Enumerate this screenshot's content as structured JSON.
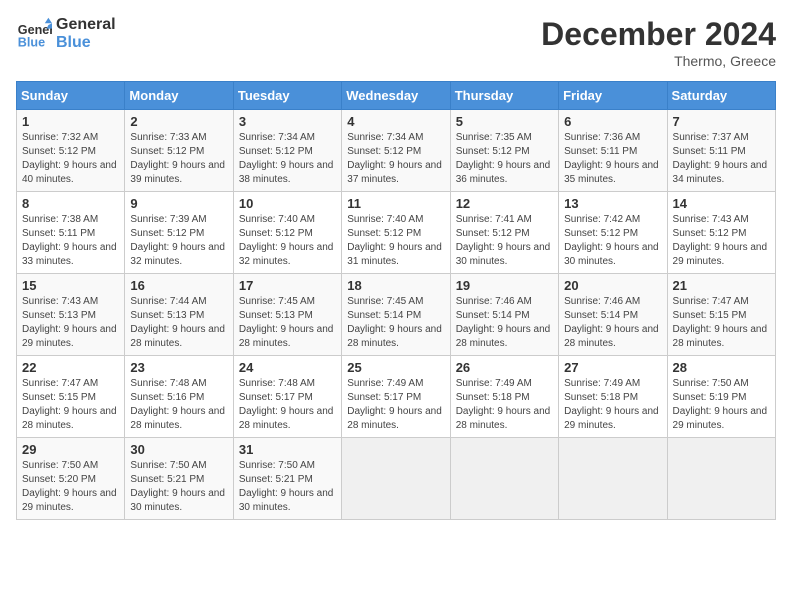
{
  "header": {
    "logo_line1": "General",
    "logo_line2": "Blue",
    "month": "December 2024",
    "location": "Thermo, Greece"
  },
  "days_of_week": [
    "Sunday",
    "Monday",
    "Tuesday",
    "Wednesday",
    "Thursday",
    "Friday",
    "Saturday"
  ],
  "weeks": [
    [
      {
        "day": "1",
        "sunrise": "7:32 AM",
        "sunset": "5:12 PM",
        "daylight": "9 hours and 40 minutes."
      },
      {
        "day": "2",
        "sunrise": "7:33 AM",
        "sunset": "5:12 PM",
        "daylight": "9 hours and 39 minutes."
      },
      {
        "day": "3",
        "sunrise": "7:34 AM",
        "sunset": "5:12 PM",
        "daylight": "9 hours and 38 minutes."
      },
      {
        "day": "4",
        "sunrise": "7:34 AM",
        "sunset": "5:12 PM",
        "daylight": "9 hours and 37 minutes."
      },
      {
        "day": "5",
        "sunrise": "7:35 AM",
        "sunset": "5:12 PM",
        "daylight": "9 hours and 36 minutes."
      },
      {
        "day": "6",
        "sunrise": "7:36 AM",
        "sunset": "5:11 PM",
        "daylight": "9 hours and 35 minutes."
      },
      {
        "day": "7",
        "sunrise": "7:37 AM",
        "sunset": "5:11 PM",
        "daylight": "9 hours and 34 minutes."
      }
    ],
    [
      {
        "day": "8",
        "sunrise": "7:38 AM",
        "sunset": "5:11 PM",
        "daylight": "9 hours and 33 minutes."
      },
      {
        "day": "9",
        "sunrise": "7:39 AM",
        "sunset": "5:12 PM",
        "daylight": "9 hours and 32 minutes."
      },
      {
        "day": "10",
        "sunrise": "7:40 AM",
        "sunset": "5:12 PM",
        "daylight": "9 hours and 32 minutes."
      },
      {
        "day": "11",
        "sunrise": "7:40 AM",
        "sunset": "5:12 PM",
        "daylight": "9 hours and 31 minutes."
      },
      {
        "day": "12",
        "sunrise": "7:41 AM",
        "sunset": "5:12 PM",
        "daylight": "9 hours and 30 minutes."
      },
      {
        "day": "13",
        "sunrise": "7:42 AM",
        "sunset": "5:12 PM",
        "daylight": "9 hours and 30 minutes."
      },
      {
        "day": "14",
        "sunrise": "7:43 AM",
        "sunset": "5:12 PM",
        "daylight": "9 hours and 29 minutes."
      }
    ],
    [
      {
        "day": "15",
        "sunrise": "7:43 AM",
        "sunset": "5:13 PM",
        "daylight": "9 hours and 29 minutes."
      },
      {
        "day": "16",
        "sunrise": "7:44 AM",
        "sunset": "5:13 PM",
        "daylight": "9 hours and 28 minutes."
      },
      {
        "day": "17",
        "sunrise": "7:45 AM",
        "sunset": "5:13 PM",
        "daylight": "9 hours and 28 minutes."
      },
      {
        "day": "18",
        "sunrise": "7:45 AM",
        "sunset": "5:14 PM",
        "daylight": "9 hours and 28 minutes."
      },
      {
        "day": "19",
        "sunrise": "7:46 AM",
        "sunset": "5:14 PM",
        "daylight": "9 hours and 28 minutes."
      },
      {
        "day": "20",
        "sunrise": "7:46 AM",
        "sunset": "5:14 PM",
        "daylight": "9 hours and 28 minutes."
      },
      {
        "day": "21",
        "sunrise": "7:47 AM",
        "sunset": "5:15 PM",
        "daylight": "9 hours and 28 minutes."
      }
    ],
    [
      {
        "day": "22",
        "sunrise": "7:47 AM",
        "sunset": "5:15 PM",
        "daylight": "9 hours and 28 minutes."
      },
      {
        "day": "23",
        "sunrise": "7:48 AM",
        "sunset": "5:16 PM",
        "daylight": "9 hours and 28 minutes."
      },
      {
        "day": "24",
        "sunrise": "7:48 AM",
        "sunset": "5:17 PM",
        "daylight": "9 hours and 28 minutes."
      },
      {
        "day": "25",
        "sunrise": "7:49 AM",
        "sunset": "5:17 PM",
        "daylight": "9 hours and 28 minutes."
      },
      {
        "day": "26",
        "sunrise": "7:49 AM",
        "sunset": "5:18 PM",
        "daylight": "9 hours and 28 minutes."
      },
      {
        "day": "27",
        "sunrise": "7:49 AM",
        "sunset": "5:18 PM",
        "daylight": "9 hours and 29 minutes."
      },
      {
        "day": "28",
        "sunrise": "7:50 AM",
        "sunset": "5:19 PM",
        "daylight": "9 hours and 29 minutes."
      }
    ],
    [
      {
        "day": "29",
        "sunrise": "7:50 AM",
        "sunset": "5:20 PM",
        "daylight": "9 hours and 29 minutes."
      },
      {
        "day": "30",
        "sunrise": "7:50 AM",
        "sunset": "5:21 PM",
        "daylight": "9 hours and 30 minutes."
      },
      {
        "day": "31",
        "sunrise": "7:50 AM",
        "sunset": "5:21 PM",
        "daylight": "9 hours and 30 minutes."
      },
      null,
      null,
      null,
      null
    ]
  ]
}
